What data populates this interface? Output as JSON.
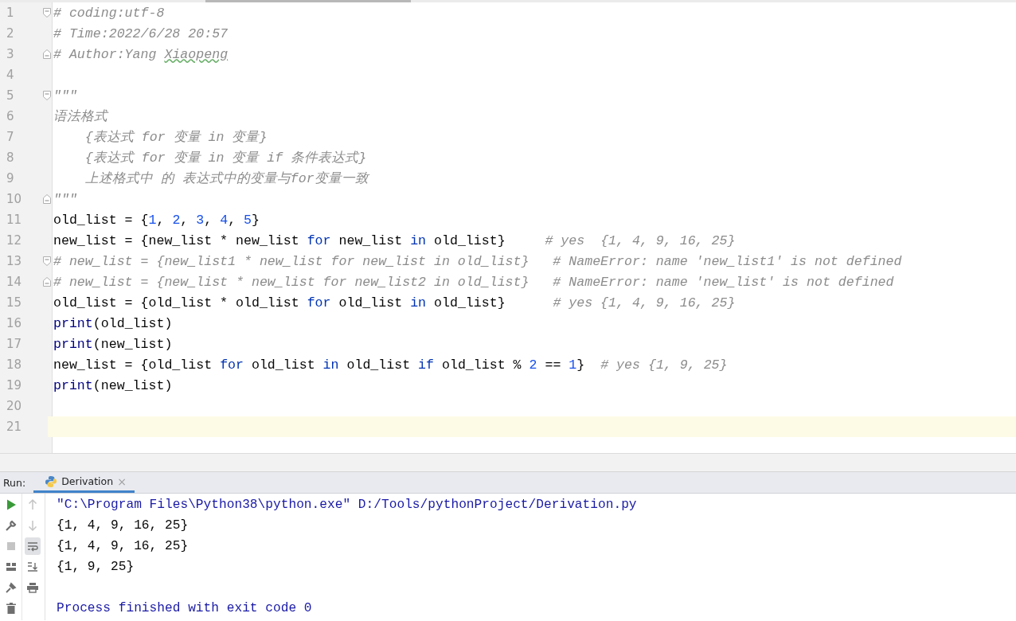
{
  "editor": {
    "lines": [
      {
        "number": "1",
        "fold_start": true,
        "segments": [
          {
            "text": "# coding:utf-8",
            "kind": "comment"
          }
        ]
      },
      {
        "number": "2",
        "segments": [
          {
            "text": "# Time:2022/6/28 20:57",
            "kind": "comment"
          }
        ]
      },
      {
        "number": "3",
        "fold_end": true,
        "segments": [
          {
            "text": "# Author:Yang ",
            "kind": "comment"
          },
          {
            "text": "Xiaopeng",
            "kind": "typo"
          }
        ]
      },
      {
        "number": "4"
      },
      {
        "number": "5",
        "fold_start": true,
        "segments": [
          {
            "text": "\"\"\"",
            "kind": "docstring"
          }
        ]
      },
      {
        "number": "6",
        "segments": [
          {
            "text": "语法格式",
            "kind": "docstring"
          }
        ]
      },
      {
        "number": "7",
        "segments": [
          {
            "text": "    {表达式 for 变量 in 变量}",
            "kind": "docstring"
          }
        ]
      },
      {
        "number": "8",
        "segments": [
          {
            "text": "    {表达式 for 变量 in 变量 if 条件表达式}",
            "kind": "docstring"
          }
        ]
      },
      {
        "number": "9",
        "segments": [
          {
            "text": "    上述格式中 的 表达式中的变量与for变量一致",
            "kind": "docstring"
          }
        ]
      },
      {
        "number": "10",
        "fold_end": true,
        "segments": [
          {
            "text": "\"\"\"",
            "kind": "docstring"
          }
        ]
      },
      {
        "number": "11",
        "segments": [
          {
            "text": "old_list = {",
            "kind": "plain"
          },
          {
            "text": "1",
            "kind": "number"
          },
          {
            "text": ", ",
            "kind": "plain"
          },
          {
            "text": "2",
            "kind": "number"
          },
          {
            "text": ", ",
            "kind": "plain"
          },
          {
            "text": "3",
            "kind": "number"
          },
          {
            "text": ", ",
            "kind": "plain"
          },
          {
            "text": "4",
            "kind": "number"
          },
          {
            "text": ", ",
            "kind": "plain"
          },
          {
            "text": "5",
            "kind": "number"
          },
          {
            "text": "}",
            "kind": "plain"
          }
        ]
      },
      {
        "number": "12",
        "segments": [
          {
            "text": "new_list = {new_list * new_list ",
            "kind": "plain"
          },
          {
            "text": "for",
            "kind": "keyword"
          },
          {
            "text": " new_list ",
            "kind": "plain"
          },
          {
            "text": "in",
            "kind": "keyword"
          },
          {
            "text": " old_list}     ",
            "kind": "plain"
          },
          {
            "text": "# yes  {1, 4, 9, 16, 25}",
            "kind": "comment"
          }
        ]
      },
      {
        "number": "13",
        "fold_start": true,
        "segments": [
          {
            "text": "# new_list = {new_list1 * new_list for new_list in old_list}   # NameError: name 'new_list1' is not defined",
            "kind": "comment"
          }
        ]
      },
      {
        "number": "14",
        "fold_end": true,
        "segments": [
          {
            "text": "# new_list = {new_list * new_list for new_list2 in old_list}   # NameError: name 'new_list' is not defined",
            "kind": "comment"
          }
        ]
      },
      {
        "number": "15",
        "segments": [
          {
            "text": "old_list = {old_list * old_list ",
            "kind": "plain"
          },
          {
            "text": "for",
            "kind": "keyword"
          },
          {
            "text": " old_list ",
            "kind": "plain"
          },
          {
            "text": "in",
            "kind": "keyword"
          },
          {
            "text": " old_list}      ",
            "kind": "plain"
          },
          {
            "text": "# yes {1, 4, 9, 16, 25}",
            "kind": "comment"
          }
        ]
      },
      {
        "number": "16",
        "segments": [
          {
            "text": "print",
            "kind": "builtin"
          },
          {
            "text": "(old_list)",
            "kind": "plain"
          }
        ]
      },
      {
        "number": "17",
        "segments": [
          {
            "text": "print",
            "kind": "builtin"
          },
          {
            "text": "(new_list)",
            "kind": "plain"
          }
        ]
      },
      {
        "number": "18",
        "segments": [
          {
            "text": "new_list = {old_list ",
            "kind": "plain"
          },
          {
            "text": "for",
            "kind": "keyword"
          },
          {
            "text": " old_list ",
            "kind": "plain"
          },
          {
            "text": "in",
            "kind": "keyword"
          },
          {
            "text": " old_list ",
            "kind": "plain"
          },
          {
            "text": "if",
            "kind": "keyword"
          },
          {
            "text": " old_list % ",
            "kind": "plain"
          },
          {
            "text": "2",
            "kind": "number"
          },
          {
            "text": " == ",
            "kind": "plain"
          },
          {
            "text": "1",
            "kind": "number"
          },
          {
            "text": "}  ",
            "kind": "plain"
          },
          {
            "text": "# yes {1, 9, 25}",
            "kind": "comment"
          }
        ]
      },
      {
        "number": "19",
        "segments": [
          {
            "text": "print",
            "kind": "builtin"
          },
          {
            "text": "(new_list)",
            "kind": "plain"
          }
        ]
      },
      {
        "number": "20"
      },
      {
        "number": "21",
        "current": true
      }
    ]
  },
  "run_panel": {
    "label": "Run:",
    "tabs": [
      {
        "title": "Derivation",
        "selected": true,
        "close": "×"
      }
    ],
    "toolbar": [
      {
        "kind": "run",
        "disabled": false
      },
      {
        "kind": "up",
        "disabled": true
      },
      {
        "kind": "wrench",
        "disabled": false
      },
      {
        "kind": "down",
        "disabled": true
      },
      {
        "kind": "stop",
        "disabled": true
      },
      {
        "kind": "wrap",
        "disabled": false,
        "selected": true
      },
      {
        "kind": "layout",
        "disabled": false
      },
      {
        "kind": "scroll-end",
        "disabled": false
      },
      {
        "kind": "pin",
        "disabled": false
      },
      {
        "kind": "print",
        "disabled": false
      },
      {
        "kind": "trash",
        "disabled": false
      }
    ],
    "console": [
      {
        "text": "\"C:\\Program Files\\Python38\\python.exe\" D:/Tools/pythonProject/Derivation.py",
        "kind": "command"
      },
      {
        "text": "{1, 4, 9, 16, 25}",
        "kind": "output"
      },
      {
        "text": "{1, 4, 9, 16, 25}",
        "kind": "output"
      },
      {
        "text": "{1, 9, 25}",
        "kind": "output"
      },
      {
        "text": "Process finished with exit code 0",
        "kind": "exit"
      }
    ]
  }
}
